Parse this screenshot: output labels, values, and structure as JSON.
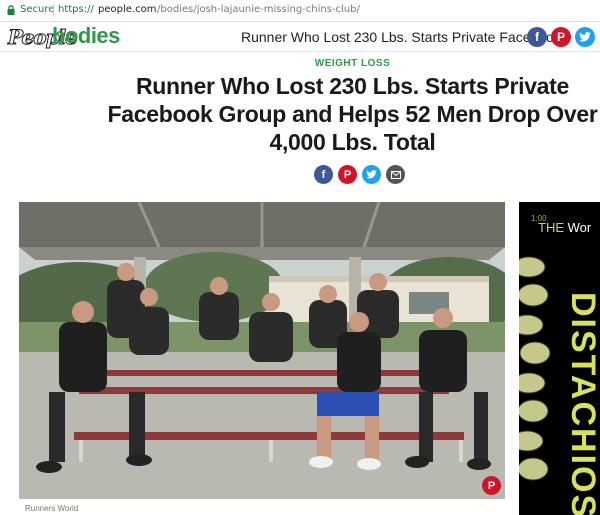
{
  "browser": {
    "secure_label": "Secure",
    "url_protocol": "https://",
    "url_host": "people.com",
    "url_path": "/bodies/josh-lajaunie-missing-chins-club/"
  },
  "site": {
    "logo_people": "People",
    "logo_bodies": "bodies",
    "header_title": "Runner Who Lost 230 Lbs. Starts Private Faceboo…",
    "header_share_icons": [
      "facebook-icon",
      "pinterest-icon",
      "twitter-icon"
    ]
  },
  "article": {
    "category": "WEIGHT LOSS",
    "headline": "Runner Who Lost 230 Lbs. Starts Private Facebook Group and Helps 52 Men Drop Over 4,000 Lbs. Total",
    "share_icons": [
      "facebook-icon",
      "pinterest-icon",
      "twitter-icon",
      "email-icon"
    ],
    "photo_credit": "Runners World"
  },
  "ad": {
    "time": "1:00",
    "brand_prefix": "THE",
    "brand_word": "Wor",
    "vertical_text": "DISTACHIOS"
  },
  "colors": {
    "green": "#2e9a47",
    "facebook": "#3b5998",
    "pinterest": "#d0142a",
    "twitter": "#1da1f2",
    "email": "#555555"
  }
}
